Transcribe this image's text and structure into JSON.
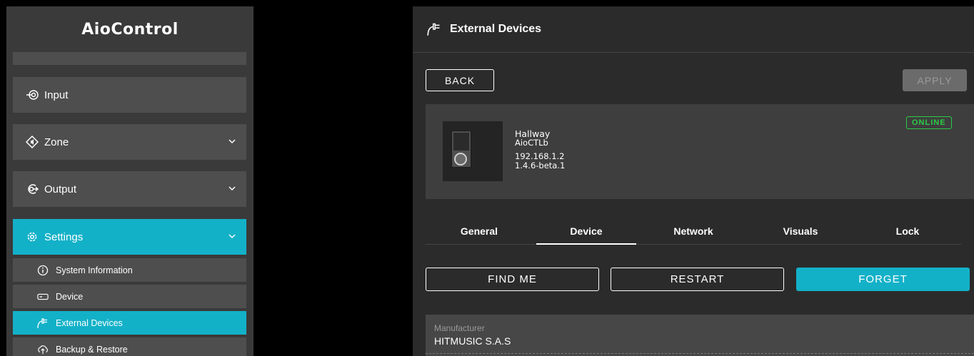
{
  "app": {
    "title": "AioControl"
  },
  "sidebar": {
    "items": [
      {
        "label": "Input",
        "icon": "input-icon"
      },
      {
        "label": "Zone",
        "icon": "zone-icon"
      },
      {
        "label": "Output",
        "icon": "output-icon"
      },
      {
        "label": "Settings",
        "icon": "gear-icon"
      }
    ],
    "subitems": [
      {
        "label": "System Information",
        "icon": "info-icon"
      },
      {
        "label": "Device",
        "icon": "device-icon"
      },
      {
        "label": "External Devices",
        "icon": "external-devices-icon"
      },
      {
        "label": "Backup & Restore",
        "icon": "backup-icon"
      }
    ]
  },
  "panel": {
    "title": "External Devices",
    "back_label": "BACK",
    "apply_label": "APPLY",
    "device": {
      "name": "Hallway",
      "model": "AioCTLb",
      "ip": "192.168.1.2",
      "version": "1.4.6-beta.1",
      "status": "ONLINE"
    },
    "tabs": [
      "General",
      "Device",
      "Network",
      "Visuals",
      "Lock"
    ],
    "actions": {
      "find": "FIND ME",
      "restart": "RESTART",
      "forget": "FORGET"
    },
    "field": {
      "label": "Manufacturer",
      "value": "HITMUSIC S.A.S"
    }
  },
  "colors": {
    "accent": "#13b1c8",
    "online": "#2bcc47",
    "panel": "#2b2b2b",
    "sidebar": "#3a3a3a"
  }
}
